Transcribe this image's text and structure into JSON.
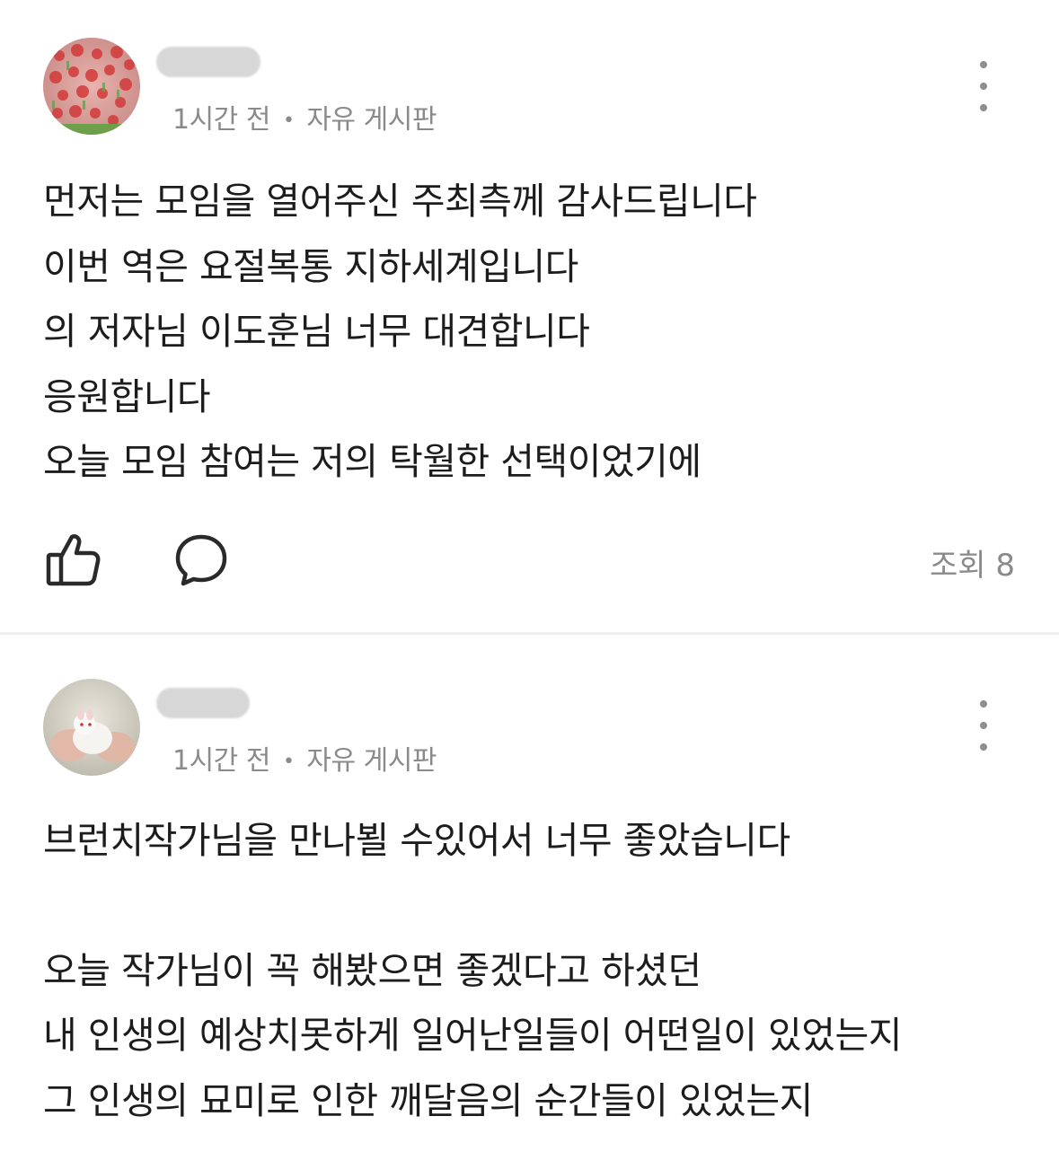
{
  "posts": [
    {
      "time": "1시간 전",
      "board": "자유 게시판",
      "lines": [
        "먼저는 모임을 열어주신 주최측께 감사드립니다",
        "이번 역은 요절복통 지하세계입니다",
        "의 저자님 이도훈님 너무 대견합니다",
        "응원합니다",
        "오늘 모임 참여는 저의 탁월한 선택이었기에"
      ],
      "views": "조회 8"
    },
    {
      "time": "1시간 전",
      "board": "자유 게시판",
      "lines": [
        "브런치작가님을 만나뵐 수있어서 너무 좋았습니다",
        "",
        "오늘 작가님이 꼭 해봤으면 좋겠다고 하셨던",
        "내 인생의 예상치못하게 일어난일들이 어떤일이 있었는지",
        "그 인생의 묘미로 인한 깨달음의 순간들이 있었는지"
      ]
    }
  ],
  "colors": {
    "meta": "#8a8a8a",
    "body": "#1c1c1c",
    "divider": "#eeeeee"
  },
  "icons": {
    "like": "thumbs-up-icon",
    "comment": "speech-bubble-icon",
    "more": "vertical-ellipsis-icon"
  }
}
